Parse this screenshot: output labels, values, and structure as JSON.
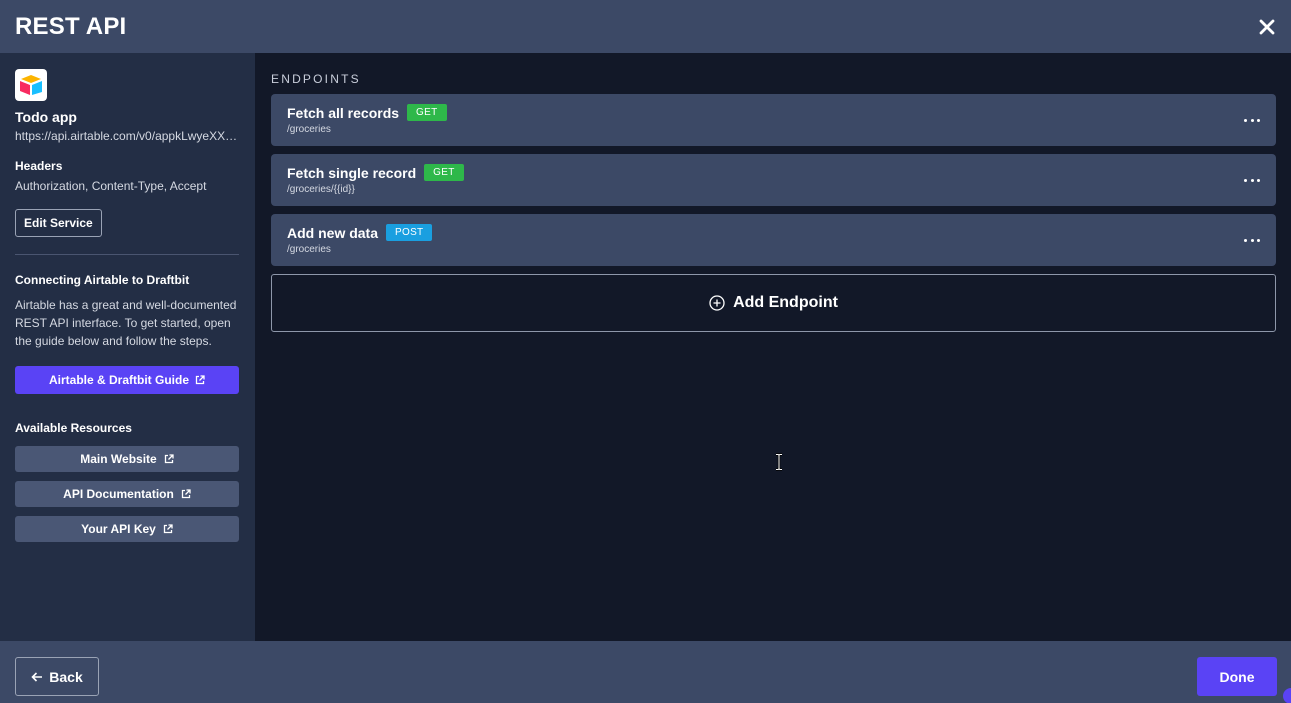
{
  "window": {
    "title": "REST API",
    "close_icon": "close-icon"
  },
  "sidebar": {
    "service": {
      "logo_icon": "airtable-logo-icon",
      "name": "Todo app",
      "url": "https://api.airtable.com/v0/appkLwyeXXXXXXXX"
    },
    "headers": {
      "label": "Headers",
      "value": "Authorization, Content-Type, Accept"
    },
    "edit_service_label": "Edit Service",
    "connect": {
      "title": "Connecting Airtable to Draftbit",
      "description": "Airtable has a great and well-documented REST API interface. To get started, open the guide below and follow the steps.",
      "guide_button": "Airtable & Draftbit Guide"
    },
    "resources": {
      "title": "Available Resources",
      "items": [
        {
          "label": "Main Website"
        },
        {
          "label": "API Documentation"
        },
        {
          "label": "Your API Key"
        }
      ]
    }
  },
  "main": {
    "section_label": "ENDPOINTS",
    "endpoints": [
      {
        "name": "Fetch all records",
        "method": "GET",
        "path": "/groceries"
      },
      {
        "name": "Fetch single record",
        "method": "GET",
        "path": "/groceries/{{id}}"
      },
      {
        "name": "Add new data",
        "method": "POST",
        "path": "/groceries"
      }
    ],
    "add_endpoint_label": "Add Endpoint"
  },
  "footer": {
    "back_label": "Back",
    "done_label": "Done"
  },
  "colors": {
    "accent": "#5a43f5",
    "get_badge": "#2eb84a",
    "post_badge": "#1a9fe0",
    "panel": "#3c4966",
    "sidebar_bg": "#232e45",
    "main_bg": "#121828"
  }
}
